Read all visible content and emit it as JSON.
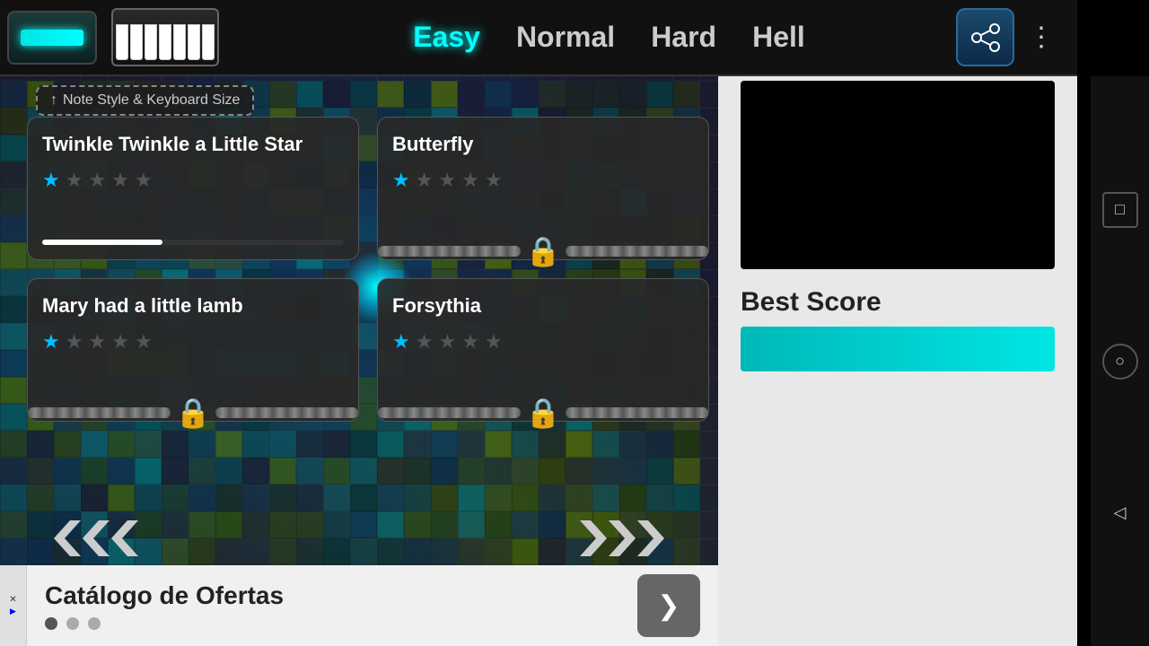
{
  "topbar": {
    "green_bar_label": "",
    "piano_label": "",
    "difficulty_tabs": [
      {
        "key": "easy",
        "label": "Easy",
        "active": true
      },
      {
        "key": "normal",
        "label": "Normal",
        "active": false
      },
      {
        "key": "hard",
        "label": "Hard",
        "active": false
      },
      {
        "key": "hell",
        "label": "Hell",
        "active": false
      }
    ],
    "share_icon": "⤴",
    "more_icon": "⋮"
  },
  "note_style_bar": {
    "label": "↑ Note Style & Keyboard Size"
  },
  "songs": [
    {
      "id": "twinkle",
      "title": "Twinkle Twinkle a Little Star",
      "stars": [
        true,
        false,
        false,
        false,
        false
      ],
      "locked": false,
      "progress": 40
    },
    {
      "id": "butterfly",
      "title": "Butterfly",
      "stars": [
        true,
        false,
        false,
        false,
        false
      ],
      "locked": true,
      "progress": 0
    },
    {
      "id": "mary",
      "title": "Mary had a little lamb",
      "stars": [
        true,
        false,
        false,
        false,
        false
      ],
      "locked": true,
      "progress": 0
    },
    {
      "id": "forsythia",
      "title": "Forsythia",
      "stars": [
        true,
        false,
        false,
        false,
        false
      ],
      "locked": true,
      "progress": 0
    }
  ],
  "nav": {
    "prev_label": "←",
    "next_label": "→"
  },
  "right_panel": {
    "best_score_label": "Best Score"
  },
  "sys_nav": {
    "square_icon": "□",
    "circle_icon": "○",
    "triangle_icon": "◁"
  },
  "ad": {
    "title": "Catálogo de Ofertas",
    "dots": [
      true,
      false,
      false
    ],
    "arrow_label": "❯",
    "close_label": "✕",
    "ad_icon": "🔷"
  }
}
